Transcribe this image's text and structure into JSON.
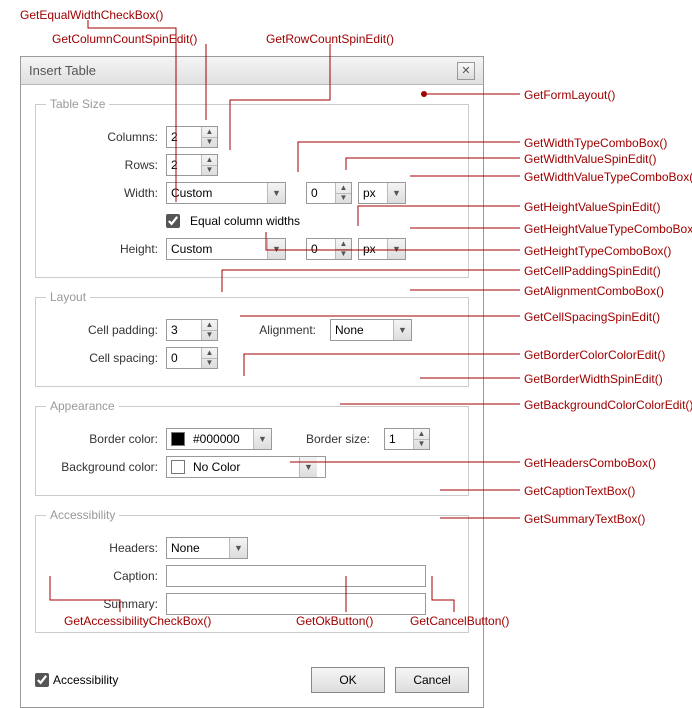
{
  "dialog": {
    "title": "Insert Table",
    "sections": {
      "tableSize": {
        "legend": "Table Size",
        "columnsLabel": "Columns:",
        "columnsValue": "2",
        "rowsLabel": "Rows:",
        "rowsValue": "2",
        "widthLabel": "Width:",
        "widthType": "Custom",
        "widthValue": "0",
        "widthUnit": "px",
        "equalWidthsLabel": "Equal column widths",
        "equalWidthsChecked": true,
        "heightLabel": "Height:",
        "heightType": "Custom",
        "heightValue": "0",
        "heightUnit": "px"
      },
      "layout": {
        "legend": "Layout",
        "cellPaddingLabel": "Cell padding:",
        "cellPaddingValue": "3",
        "cellSpacingLabel": "Cell spacing:",
        "cellSpacingValue": "0",
        "alignmentLabel": "Alignment:",
        "alignmentValue": "None"
      },
      "appearance": {
        "legend": "Appearance",
        "borderColorLabel": "Border color:",
        "borderColorValue": "#000000",
        "borderColorSwatch": "#000000",
        "borderSizeLabel": "Border size:",
        "borderSizeValue": "1",
        "bgColorLabel": "Background color:",
        "bgColorValue": "No Color",
        "bgColorSwatch": "#ffffff"
      },
      "accessibility": {
        "legend": "Accessibility",
        "headersLabel": "Headers:",
        "headersValue": "None",
        "captionLabel": "Caption:",
        "captionValue": "",
        "summaryLabel": "Summary:",
        "summaryValue": ""
      }
    },
    "footer": {
      "accessibilityLabel": "Accessibility",
      "accessibilityChecked": true,
      "okLabel": "OK",
      "cancelLabel": "Cancel"
    }
  },
  "callouts": {
    "getEqualWidthCheckBox": "GetEqualWidthCheckBox()",
    "getColumnCountSpinEdit": "GetColumnCountSpinEdit()",
    "getRowCountSpinEdit": "GetRowCountSpinEdit()",
    "getFormLayout": "GetFormLayout()",
    "getWidthTypeComboBox": "GetWidthTypeComboBox()",
    "getWidthValueSpinEdit": "GetWidthValueSpinEdit()",
    "getWidthValueTypeComboBox": "GetWidthValueTypeComboBox()",
    "getHeightValueSpinEdit": "GetHeightValueSpinEdit()",
    "getHeightValueTypeComboBox": "GetHeightValueTypeComboBox()",
    "getHeightTypeComboBox": "GetHeightTypeComboBox()",
    "getCellPaddingSpinEdit": "GetCellPaddingSpinEdit()",
    "getAlignmentComboBox": "GetAlignmentComboBox()",
    "getCellSpacingSpinEdit": "GetCellSpacingSpinEdit()",
    "getBorderColorColorEdit": "GetBorderColorColorEdit()",
    "getBorderWidthSpinEdit": "GetBorderWidthSpinEdit()",
    "getBackgroundColorColorEdit": "GetBackgroundColorColorEdit()",
    "getHeadersComboBox": "GetHeadersComboBox()",
    "getCaptionTextBox": "GetCaptionTextBox()",
    "getSummaryTextBox": "GetSummaryTextBox()",
    "getAccessibilityCheckBox": "GetAccessibilityCheckBox()",
    "getOkButton": "GetOkButton()",
    "getCancelButton": "GetCancelButton()"
  }
}
